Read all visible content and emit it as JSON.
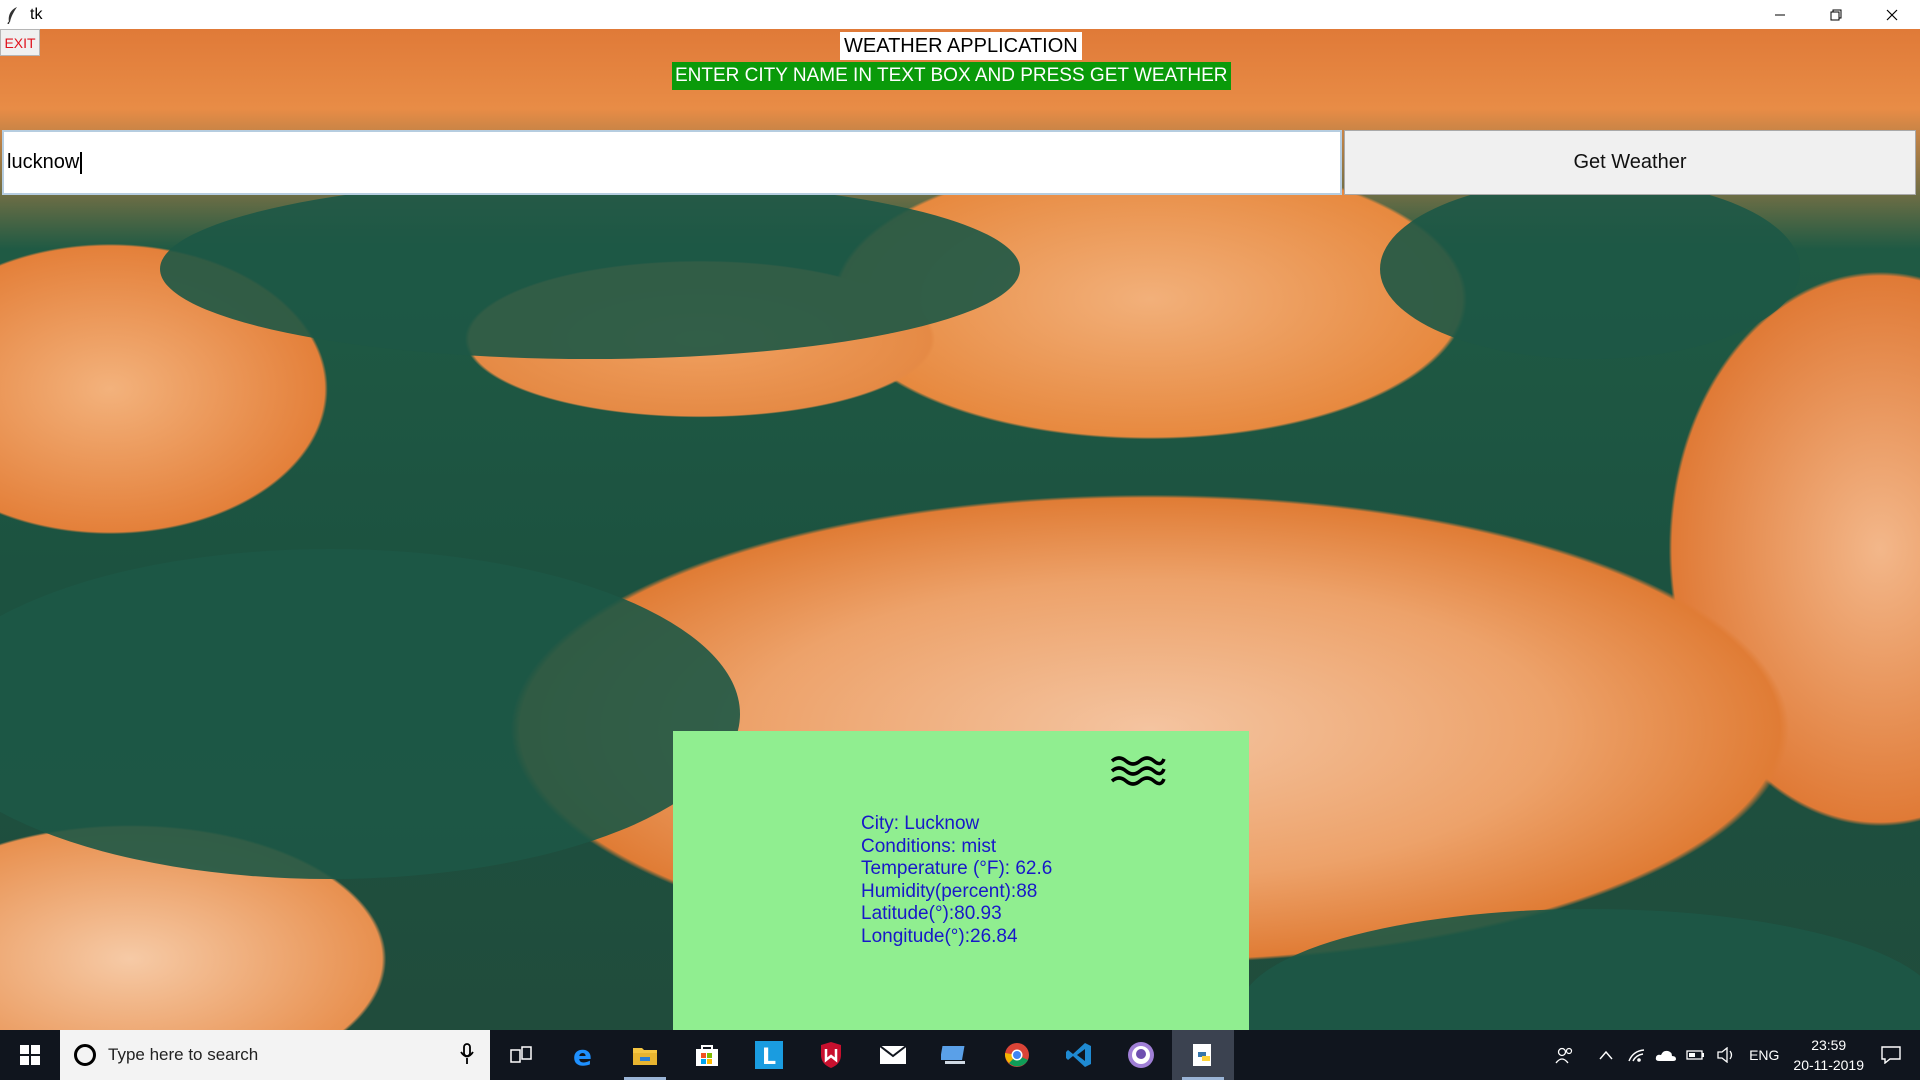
{
  "window": {
    "title": "tk",
    "icon": "feather-icon",
    "controls": [
      "minimize-icon",
      "restore-icon",
      "close-icon"
    ]
  },
  "app": {
    "exit_label": "EXIT",
    "title": "WEATHER APPLICATION",
    "subtitle": "ENTER CITY NAME IN TEXT BOX AND PRESS GET WEATHER",
    "city_input_value": "lucknow",
    "get_weather_label": "Get Weather"
  },
  "result": {
    "icon": "mist-icon",
    "lines": [
      "City: Lucknow",
      "Conditions: mist",
      "Temperature (°F): 62.6",
      "Humidity(percent):88",
      "Latitude(°):80.93",
      "Longitude(°):26.84"
    ]
  },
  "taskbar": {
    "search_placeholder": "Type here to search",
    "apps": [
      "task-view-icon",
      "edge-icon",
      "file-explorer-icon",
      "store-icon",
      "l-app-icon",
      "mcafee-icon",
      "mail-icon",
      "network-pc-icon",
      "chrome-icon",
      "vscode-icon",
      "github-icon",
      "python-icon"
    ],
    "tray": {
      "language": "ENG",
      "time": "23:59",
      "date": "20-11-2019"
    }
  },
  "colors": {
    "subtitle_bg": "#0a9a0a",
    "panel_bg": "#90ee90",
    "result_text": "#1818c8",
    "exit_text": "#e0121d"
  }
}
